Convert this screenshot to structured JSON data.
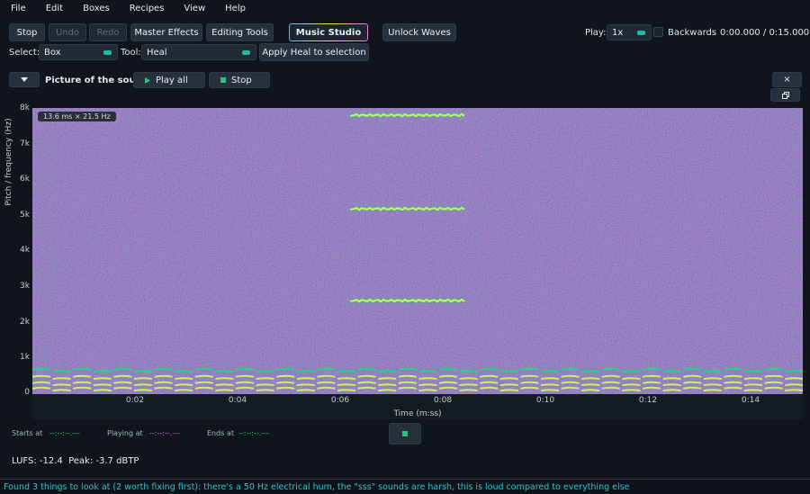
{
  "menu": [
    "File",
    "Edit",
    "Boxes",
    "Recipes",
    "View",
    "Help"
  ],
  "toolbar": {
    "stop": "Stop",
    "undo": "Undo",
    "redo": "Redo",
    "master_effects": "Master Effects",
    "editing_tools": "Editing Tools",
    "music_studio": "Music Studio",
    "unlock_waves": "Unlock Waves",
    "play_label": "Play:",
    "speed": "1x",
    "backwards": "Backwards",
    "backwards_checked": false,
    "time": "0:00.000 / 0:15.000"
  },
  "tools": {
    "select_label": "Select:",
    "select_value": "Box",
    "tool_label": "Tool:",
    "tool_value": "Heal",
    "apply": "Apply Heal to selection"
  },
  "panel": {
    "title": "Picture of the sound",
    "play_all": "Play all",
    "stop": "Stop",
    "close": "×"
  },
  "spectrogram": {
    "resolution": "13.6 ms  ×  21.5 Hz",
    "ylabel": "Pitch / frequency (Hz)",
    "xlabel": "Time (m:ss)",
    "yticks": [
      "8k",
      "7k",
      "6k",
      "5k",
      "4k",
      "3k",
      "2k",
      "1k",
      "0"
    ],
    "xticks": [
      "0:02",
      "0:04",
      "0:06",
      "0:08",
      "0:10",
      "0:12",
      "0:14"
    ],
    "colors": {
      "background": "#3b2f80",
      "tone": "#b6f25a",
      "hum": "#3fd07a"
    }
  },
  "markers": {
    "starts_label": "Starts at",
    "starts_value": "--:--:--.---",
    "playing_label": "Playing at",
    "playing_value": "--:--:--.---",
    "ends_label": "Ends at",
    "ends_value": "--:--:--.---"
  },
  "loudness": "LUFS: -12.4  Peak: -3.7 dBTP",
  "status": "Found 3 things to look at (2 worth fixing first): there's a 50 Hz electrical hum, the \"sss\" sounds are harsh, this is loud compared to everything else"
}
